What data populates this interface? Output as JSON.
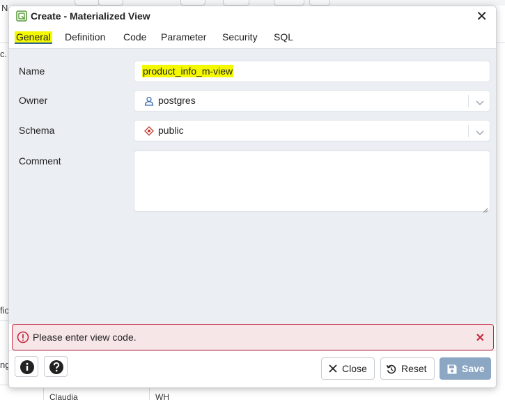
{
  "background": {
    "frag_top_left": "N",
    "frag_mid_left": "c.",
    "frag_fic": "fic",
    "frag_ng": "ng",
    "grid_cells": [
      "Claudia",
      "WH"
    ]
  },
  "dialog": {
    "title": "Create - Materialized View",
    "close_glyph": "✕",
    "tabs": [
      {
        "label": "General",
        "active": true
      },
      {
        "label": "Definition",
        "active": false
      },
      {
        "label": "Code",
        "active": false
      },
      {
        "label": "Parameter",
        "active": false
      },
      {
        "label": "Security",
        "active": false
      },
      {
        "label": "SQL",
        "active": false
      }
    ],
    "form": {
      "name_label": "Name",
      "name_value": "product_info_m-view",
      "owner_label": "Owner",
      "owner_value": "postgres",
      "schema_label": "Schema",
      "schema_value": "public",
      "comment_label": "Comment",
      "comment_value": ""
    },
    "error": {
      "message": "Please enter view code.",
      "close_glyph": "✕"
    },
    "footer": {
      "close_label": "Close",
      "reset_label": "Reset",
      "save_label": "Save"
    },
    "colors": {
      "highlight": "#f4f900",
      "error_border": "#c6283e",
      "error_bg": "#f7e6e8",
      "primary_disabled": "#8ca7c4",
      "content_bg": "#ebeef3"
    },
    "icons": {
      "title": "materialized-view-icon",
      "owner": "user-icon",
      "schema": "schema-icon",
      "error": "error-circle-icon",
      "info": "info-icon",
      "help": "help-icon",
      "close": "close-icon",
      "reset": "reset-icon",
      "save": "save-icon"
    }
  }
}
